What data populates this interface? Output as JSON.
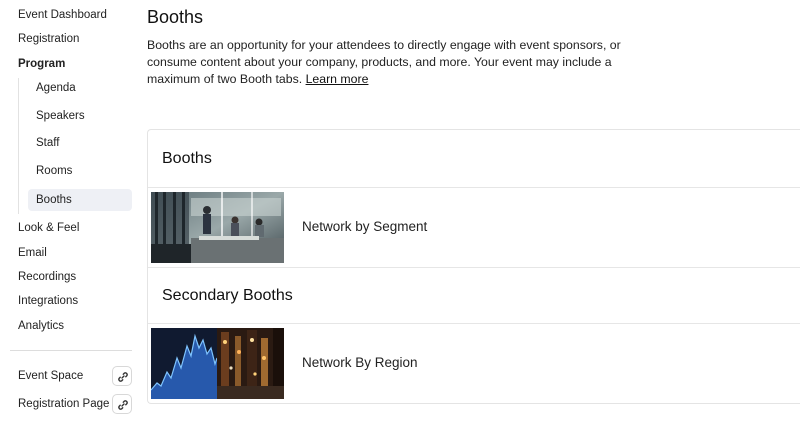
{
  "sidebar": {
    "items": [
      {
        "label": "Event Dashboard"
      },
      {
        "label": "Registration"
      },
      {
        "label": "Program"
      }
    ],
    "program_children": [
      {
        "label": "Agenda"
      },
      {
        "label": "Speakers"
      },
      {
        "label": "Staff"
      },
      {
        "label": "Rooms"
      },
      {
        "label": "Booths",
        "active": true
      }
    ],
    "items_after": [
      {
        "label": "Look & Feel"
      },
      {
        "label": "Email"
      },
      {
        "label": "Recordings"
      },
      {
        "label": "Integrations"
      },
      {
        "label": "Analytics"
      }
    ],
    "links": [
      {
        "label": "Event Space",
        "icon": "link-icon"
      },
      {
        "label": "Registration Page",
        "icon": "link-icon"
      }
    ]
  },
  "main": {
    "title": "Booths",
    "description": "Booths are an opportunity for your attendees to directly engage with event sponsors, or consume content about your company, products, and more. Your event may include a maximum of two Booth tabs.",
    "learn_more": "Learn more",
    "sections": [
      {
        "heading": "Booths",
        "booth": {
          "name": "Network by Segment",
          "image": "office-people-photo"
        }
      },
      {
        "heading": "Secondary Booths",
        "booth": {
          "name": "Network By Region",
          "image": "stock-chart-city-photo"
        }
      }
    ]
  },
  "colors": {
    "active_bg": "#eef0f5",
    "border": "#e4e4e4",
    "text": "#222222"
  }
}
